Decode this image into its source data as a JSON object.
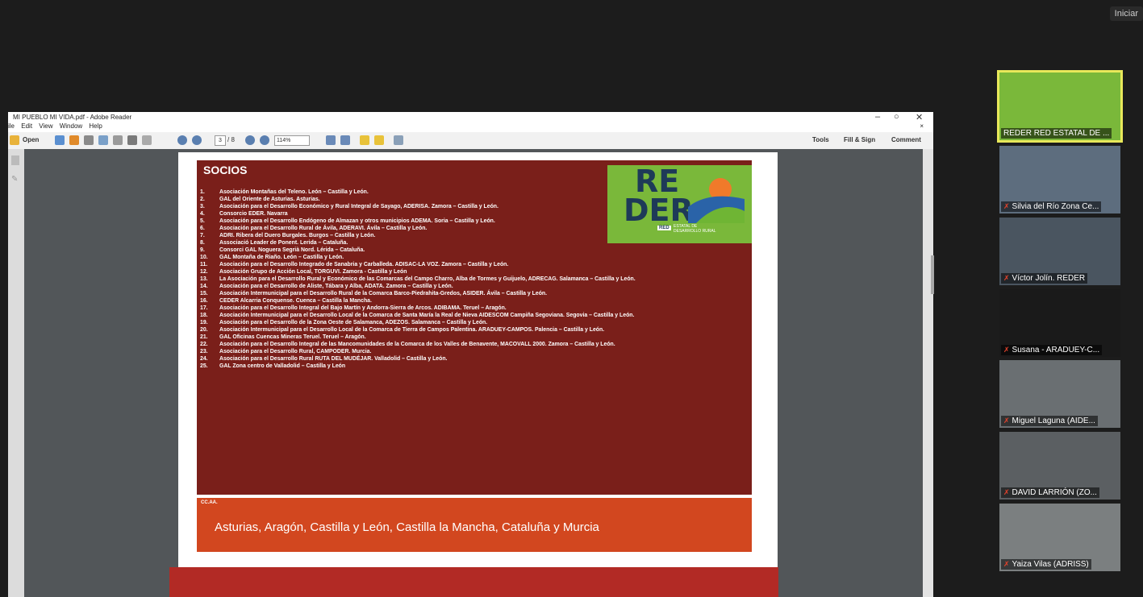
{
  "topbar": {
    "start_label": "Iniciar"
  },
  "reader": {
    "title": "MI PUEBLO MI VIDA.pdf - Adobe Reader",
    "menu": [
      "ile",
      "Edit",
      "View",
      "Window",
      "Help"
    ],
    "toolbar": {
      "open_label": "Open",
      "page_current": "3",
      "page_total": "/ 8",
      "zoom": "114%",
      "tools_label": "Tools",
      "fill_sign_label": "Fill & Sign",
      "comment_label": "Comment"
    }
  },
  "document": {
    "socios_title": "SOCIOS",
    "socios": [
      "Asociación Montañas del Teleno. León – Castilla y León.",
      "GAL del Oriente de Asturias. Asturias.",
      "Asociación para el Desarrollo Económico y Rural Integral de Sayago, ADERISA. Zamora – Castilla y León.",
      "Consorcio EDER. Navarra",
      "Asociación para el Desarrollo Endógeno de Almazan y otros municipios ADEMA. Soria – Castilla y León.",
      "Asociación para el Desarrollo Rural de Ávila, ADERAVI. Ávila – Castilla y León.",
      "ADRI. Ribera del Duero Burgales. Burgos – Castilla y León.",
      "Associació Leader de Ponent. Lerida – Cataluña.",
      "Consorci GAL Noguera Segrià Nord. Lérida – Cataluña.",
      "GAL Montaña de Riaño. León – Castilla y León.",
      "Asociación para el Desarrollo Integrado de Sanabria y Carballeda. ADISAC-LA VOZ. Zamora – Castilla y León.",
      "Asociación Grupo de Acción Local, TORGUVI. Zamora - Castilla y León",
      "La Asociación para el Desarrollo Rural y Económico de las Comarcas del Campo Charro, Alba de Tormes y Guijuelo, ADRECAG. Salamanca – Castilla y León.",
      "Asociación para el Desarrollo de Aliste, Tábara y Alba, ADATA. Zamora – Castilla y León.",
      "Asociación Intermunicipal para el Desarrollo Rural de la Comarca Barco-Piedrahita-Gredos, ASIDER. Ávila – Castilla y León.",
      "CEDER Alcarria Conquense. Cuenca – Castilla la Mancha.",
      "Asociación para el Desarrollo Integral del Bajo Martín y Andorra-Sierra de Arcos. ADIBAMA. Teruel – Aragón.",
      "Asociación Intermunicipal para el Desarrollo Local de la Comarca de Santa María la Real de Nieva AIDESCOM Campiña Segoviana. Segovia – Castilla y León.",
      "Asociación para el Desarrollo de la Zona Oeste de Salamanca, ADEZOS. Salamanca – Castilla y León.",
      "Asociación Intermunicipal para el Desarrollo Local de la Comarca de Tierra de Campos Palentina. ARADUEY-CAMPOS. Palencia – Castilla y León.",
      "GAL Oficinas Cuencas Mineras Teruel. Teruel – Aragón.",
      "Asociación para el Desarrollo Integral de las Mancomunidades de la Comarca de los Valles de Benavente, MACOVALL 2000. Zamora – Castilla y León.",
      "Asociación para el Desarrollo Rural, CAMPODER. Murcia.",
      "Asociación para el Desarrollo Rural RUTA DEL MUDÉJAR. Valladolid – Castilla y León.",
      "GAL Zona centro de Valladolid – Castilla y León"
    ],
    "logo": {
      "line1": "RE",
      "line2": "DER",
      "tag": "RED",
      "sub": "ESTATAL DE DESARROLLO RURAL"
    },
    "ccaa_label": "CC.AA.",
    "ccaa_text": "Asturias, Aragón, Castilla y León, Castilla la Mancha, Cataluña y Murcia"
  },
  "participants": [
    {
      "name": "REDER RED ESTATAL DE ...",
      "muted": false
    },
    {
      "name": "Silvia del Río Zona Ce...",
      "muted": true
    },
    {
      "name": "Víctor Jolín. REDER",
      "muted": true
    },
    {
      "name": "Susana - ARADUEY-C...",
      "muted": true
    },
    {
      "name": "Miguel Laguna (AIDE...",
      "muted": true
    },
    {
      "name": "DAVID LARRIÓN (ZO...",
      "muted": true
    },
    {
      "name": "Yaiza Vilas (ADRISS)",
      "muted": true
    }
  ]
}
